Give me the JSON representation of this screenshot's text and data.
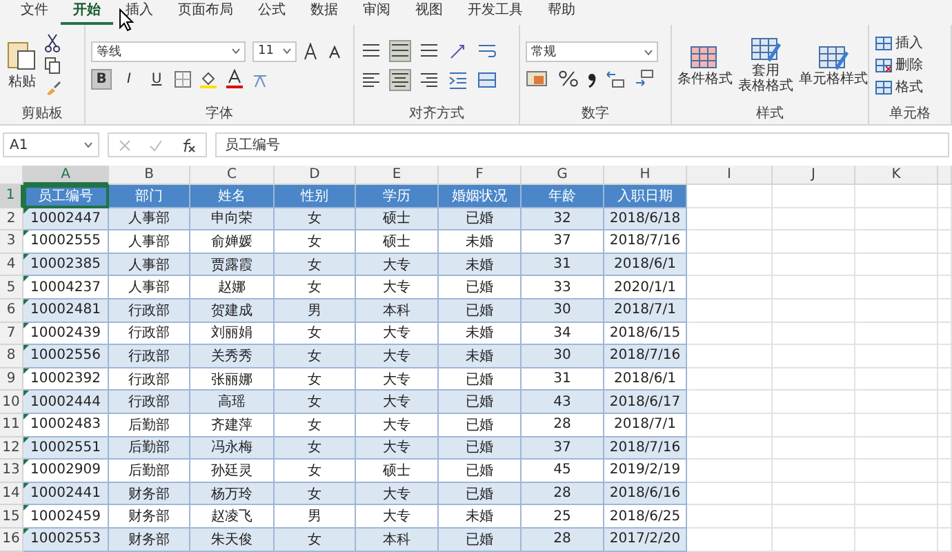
{
  "menu_tabs": [
    {
      "label": "文件",
      "selected": false
    },
    {
      "label": "开始",
      "selected": true
    },
    {
      "label": "插入",
      "selected": false
    },
    {
      "label": "页面布局",
      "selected": false
    },
    {
      "label": "公式",
      "selected": false
    },
    {
      "label": "数据",
      "selected": false
    },
    {
      "label": "审阅",
      "selected": false
    },
    {
      "label": "视图",
      "selected": false
    },
    {
      "label": "开发工具",
      "selected": false
    },
    {
      "label": "帮助",
      "selected": false
    }
  ],
  "ribbon": {
    "clipboard": {
      "paste": "粘贴",
      "label": "剪贴板"
    },
    "font": {
      "name": "等线",
      "size": "11",
      "bold": "B",
      "italic": "I",
      "underline": "U",
      "label": "字体"
    },
    "alignment": {
      "label": "对齐方式"
    },
    "number": {
      "format": "常规",
      "label": "数字"
    },
    "styles": {
      "buttons": [
        {
          "lines": [
            "条件格式"
          ]
        },
        {
          "lines": [
            "套用",
            "表格格式"
          ]
        },
        {
          "lines": [
            "单元格样式"
          ]
        }
      ],
      "label": "样式"
    },
    "cells": {
      "buttons": [
        "插入",
        "删除",
        "格式"
      ],
      "label": "单元格"
    }
  },
  "formula_bar": {
    "name_box": "A1",
    "content": "员工编号"
  },
  "sheet": {
    "columns": [
      {
        "label": "A",
        "selected": true
      },
      {
        "label": "B",
        "selected": false
      },
      {
        "label": "C",
        "selected": false
      },
      {
        "label": "D",
        "selected": false
      },
      {
        "label": "E",
        "selected": false
      },
      {
        "label": "F",
        "selected": false
      },
      {
        "label": "G",
        "selected": false
      },
      {
        "label": "H",
        "selected": false
      },
      {
        "label": "I",
        "selected": false
      },
      {
        "label": "J",
        "selected": false
      },
      {
        "label": "K",
        "selected": false
      }
    ],
    "header": {
      "number": "1",
      "selected": true,
      "cells": [
        "员工编号",
        "部门",
        "姓名",
        "性别",
        "学历",
        "婚姻状况",
        "年龄",
        "入职日期"
      ]
    },
    "rows": [
      {
        "number": "2",
        "cells": [
          "10002447",
          "人事部",
          "申向荣",
          "女",
          "硕士",
          "已婚",
          "32",
          "2018/6/18"
        ]
      },
      {
        "number": "3",
        "cells": [
          "10002555",
          "人事部",
          "俞婵媛",
          "女",
          "硕士",
          "未婚",
          "37",
          "2018/7/16"
        ]
      },
      {
        "number": "4",
        "cells": [
          "10002385",
          "人事部",
          "贾露霞",
          "女",
          "大专",
          "未婚",
          "31",
          "2018/6/1"
        ]
      },
      {
        "number": "5",
        "cells": [
          "10004237",
          "人事部",
          "赵娜",
          "女",
          "大专",
          "已婚",
          "33",
          "2020/1/1"
        ]
      },
      {
        "number": "6",
        "cells": [
          "10002481",
          "行政部",
          "贺建成",
          "男",
          "本科",
          "已婚",
          "30",
          "2018/7/1"
        ]
      },
      {
        "number": "7",
        "cells": [
          "10002439",
          "行政部",
          "刘丽娟",
          "女",
          "大专",
          "未婚",
          "34",
          "2018/6/15"
        ]
      },
      {
        "number": "8",
        "cells": [
          "10002556",
          "行政部",
          "关秀秀",
          "女",
          "大专",
          "未婚",
          "30",
          "2018/7/16"
        ]
      },
      {
        "number": "9",
        "cells": [
          "10002392",
          "行政部",
          "张丽娜",
          "女",
          "大专",
          "已婚",
          "31",
          "2018/6/1"
        ]
      },
      {
        "number": "10",
        "cells": [
          "10002444",
          "行政部",
          "高瑶",
          "女",
          "大专",
          "已婚",
          "43",
          "2018/6/17"
        ]
      },
      {
        "number": "11",
        "cells": [
          "10002483",
          "后勤部",
          "齐建萍",
          "女",
          "大专",
          "已婚",
          "28",
          "2018/7/1"
        ]
      },
      {
        "number": "12",
        "cells": [
          "10002551",
          "后勤部",
          "冯永梅",
          "女",
          "大专",
          "已婚",
          "37",
          "2018/7/16"
        ]
      },
      {
        "number": "13",
        "cells": [
          "10002909",
          "后勤部",
          "孙廷灵",
          "女",
          "硕士",
          "已婚",
          "45",
          "2019/2/19"
        ]
      },
      {
        "number": "14",
        "cells": [
          "10002441",
          "财务部",
          "杨万玲",
          "女",
          "大专",
          "已婚",
          "28",
          "2018/6/16"
        ]
      },
      {
        "number": "15",
        "cells": [
          "10002459",
          "财务部",
          "赵凌飞",
          "男",
          "大专",
          "未婚",
          "25",
          "2018/6/25"
        ]
      },
      {
        "number": "16",
        "cells": [
          "10002553",
          "财务部",
          "朱天俊",
          "女",
          "本科",
          "已婚",
          "28",
          "2017/2/20"
        ]
      }
    ]
  }
}
